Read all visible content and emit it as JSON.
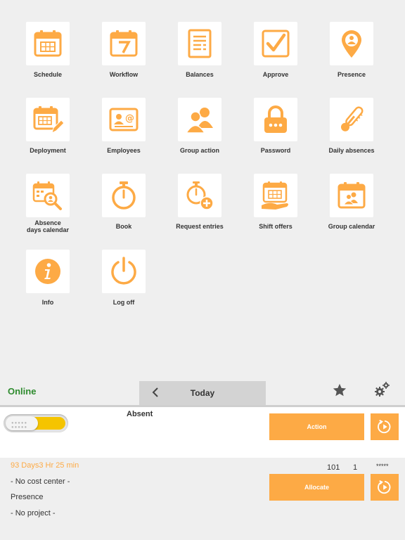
{
  "tiles": [
    {
      "label": "Schedule",
      "icon": "calendar-grid-icon"
    },
    {
      "label": "Workflow",
      "icon": "calendar-seven-icon"
    },
    {
      "label": "Balances",
      "icon": "document-list-icon"
    },
    {
      "label": "Approve",
      "icon": "checkbox-icon"
    },
    {
      "label": "Presence",
      "icon": "location-person-icon"
    },
    {
      "label": "Deployment",
      "icon": "calendar-edit-icon"
    },
    {
      "label": "Employees",
      "icon": "contact-card-icon"
    },
    {
      "label": "Group action",
      "icon": "people-icon"
    },
    {
      "label": "Password",
      "icon": "lock-icon"
    },
    {
      "label": "Daily absences",
      "icon": "thermometer-icon"
    },
    {
      "label": "Absence\ndays calendar",
      "icon": "calendar-search-icon"
    },
    {
      "label": "Book",
      "icon": "stopwatch-icon"
    },
    {
      "label": "Request entries",
      "icon": "stopwatch-add-icon"
    },
    {
      "label": "Shift offers",
      "icon": "calendar-hand-icon"
    },
    {
      "label": "Group calendar",
      "icon": "calendar-people-icon"
    },
    {
      "label": "Info",
      "icon": "info-icon"
    },
    {
      "label": "Log off",
      "icon": "power-icon"
    }
  ],
  "status_bar": {
    "online": "Online",
    "today": "Today",
    "back_icon": "chevron-left-icon",
    "favorite_icon": "star-icon",
    "settings_icon": "gears-icon"
  },
  "booking": {
    "status": "Absent",
    "action_label": "Action",
    "allocate_label": "Allocate",
    "timer_icon": "timer-refresh-icon"
  },
  "details": {
    "duration": "93 Days3 Hr 25 min",
    "cost_center": "- No cost center -",
    "type": "Presence",
    "project": "- No project -",
    "value_a": "101",
    "value_b": "1",
    "masked": "*****"
  },
  "colors": {
    "accent": "#fdaa45",
    "online": "#2e8b2e",
    "toggle": "#f5c400"
  }
}
